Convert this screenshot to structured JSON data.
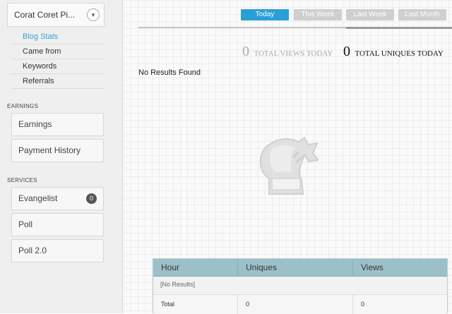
{
  "sidebar": {
    "site_name": "Corat Coret Pi...",
    "subnav": [
      "Blog Stats",
      "Came from",
      "Keywords",
      "Referrals"
    ],
    "earnings_label": "EARNINGS",
    "earnings_items": [
      "Earnings",
      "Payment History"
    ],
    "services_label": "SERVICES",
    "services_items": [
      {
        "label": "Evangelist",
        "badge": "0"
      },
      {
        "label": "Poll"
      },
      {
        "label": "Poll 2.0"
      }
    ]
  },
  "range": {
    "buttons": [
      "Today",
      "This Week",
      "Last Week",
      "Last Month"
    ],
    "active": "Today"
  },
  "stats": {
    "views_value": "0",
    "views_label": "TOTAL VIEWS TODAY",
    "uniques_value": "0",
    "uniques_label": "TOTAL UNIQUES TODAY"
  },
  "no_results_text": "No Results Found",
  "table": {
    "headers": [
      "Hour",
      "Uniques",
      "Views"
    ],
    "empty_text": "[No Results]",
    "total_label": "Total",
    "total_uniques": "0",
    "total_views": "0"
  },
  "colors": {
    "accent": "#2a9fd6",
    "link": "#3a9ed6",
    "table_header": "#9cc0c9"
  }
}
